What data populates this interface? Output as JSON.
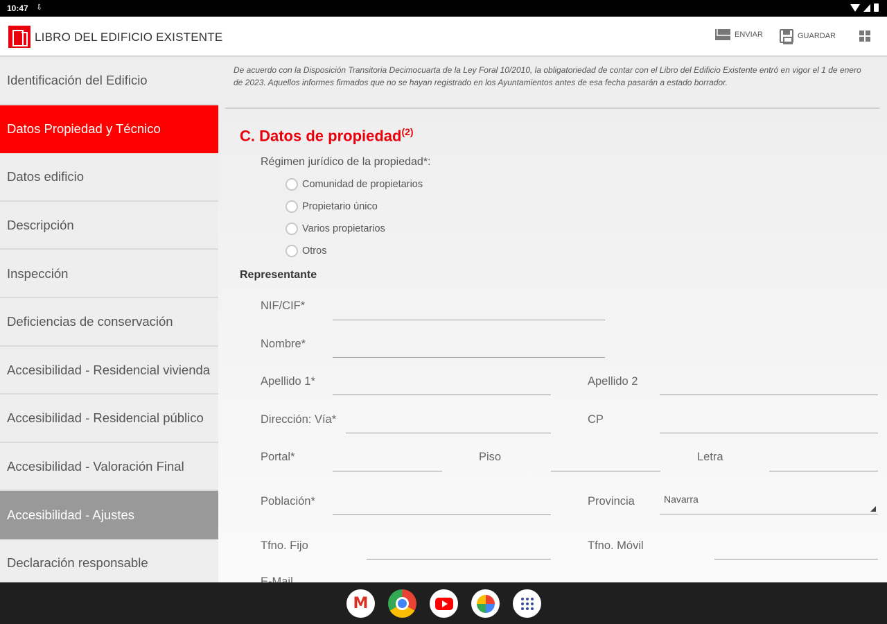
{
  "status": {
    "time": "10:47",
    "download_icon": "download-icon"
  },
  "app": {
    "title": "LIBRO DEL EDIFICIO EXISTENTE",
    "send_label": "ENVIAR",
    "save_label": "GUARDAR"
  },
  "sidebar": {
    "items": [
      {
        "label": "Identificación del Edificio"
      },
      {
        "label": "Datos Propiedad y Técnico"
      },
      {
        "label": "Datos edificio"
      },
      {
        "label": "Descripción"
      },
      {
        "label": "Inspección"
      },
      {
        "label": "Deficiencias de conservación"
      },
      {
        "label": "Accesibilidad - Residencial vivienda"
      },
      {
        "label": "Accesibilidad - Residencial público"
      },
      {
        "label": "Accesibilidad - Valoración Final"
      },
      {
        "label": "Accesibilidad - Ajustes"
      },
      {
        "label": "Declaración responsable"
      }
    ],
    "active_index": 1
  },
  "notice": "De acuerdo con la Disposición Transitoria Decimocuarta de la Ley Foral 10/2010, la obligatoriedad de contar con el Libro del Edificio Existente entró en vigor el 1 de enero de 2023. Aquellos informes firmados que no se hayan registrado en los Ayuntamientos antes de esa fecha pasarán a estado borrador.",
  "section": {
    "title": "C. Datos de propiedad",
    "footnote": "(2)",
    "regimen_label": "Régimen jurídico de la propiedad*:",
    "options": [
      "Comunidad de propietarios",
      "Propietario único",
      "Varios propietarios",
      "Otros"
    ],
    "rep_title": "Representante"
  },
  "form": {
    "nif": "NIF/CIF*",
    "nombre": "Nombre*",
    "apellido1": "Apellido 1*",
    "apellido2": "Apellido 2",
    "direccion": "Dirección: Vía*",
    "cp": "CP",
    "portal": "Portal*",
    "piso": "Piso",
    "letra": "Letra",
    "poblacion": "Población*",
    "provincia": "Provincia",
    "provincia_value": "Navarra",
    "tfno_fijo": "Tfno. Fijo",
    "tfno_movil": "Tfno. Móvil",
    "email": "E-Mail"
  },
  "dock": [
    "gmail-icon",
    "chrome-icon",
    "youtube-icon",
    "photos-icon",
    "app-launcher-icon"
  ]
}
